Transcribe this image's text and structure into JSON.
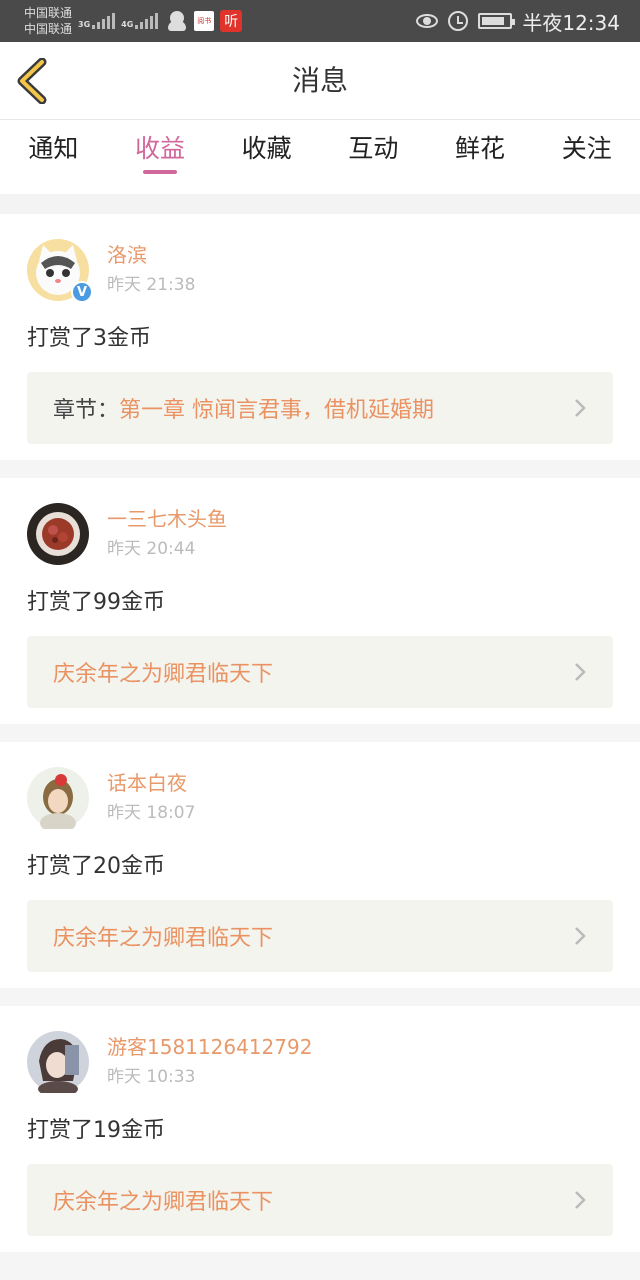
{
  "status_bar": {
    "carrier_1": "中国联通",
    "carrier_2": "中国联通",
    "net_1": "3G",
    "net_2": "4G",
    "app_icon_1": "阅书",
    "app_icon_2": "听",
    "time": "半夜12:34"
  },
  "header": {
    "title": "消息"
  },
  "tabs": [
    "通知",
    "收益",
    "收藏",
    "互动",
    "鲜花",
    "关注"
  ],
  "active_tab": "收益",
  "messages": [
    {
      "username": "洛滨",
      "time": "昨天 21:38",
      "reward": "打赏了3金币",
      "prefix": "章节：",
      "book": "第一章  惊闻言君事，借机延婚期"
    },
    {
      "username": "一三七木头鱼",
      "time": "昨天 20:44",
      "reward": "打赏了99金币",
      "prefix": "",
      "book": "庆余年之为卿君临天下"
    },
    {
      "username": "话本白夜",
      "time": "昨天 18:07",
      "reward": "打赏了20金币",
      "prefix": "",
      "book": "庆余年之为卿君临天下"
    },
    {
      "username": "游客1581126412792",
      "time": "昨天 10:33",
      "reward": "打赏了19金币",
      "prefix": "",
      "book": "庆余年之为卿君临天下"
    }
  ],
  "colors": {
    "accent": "#d1689c",
    "username": "#e8996a",
    "book_title": "#ea9262",
    "status_bar": "#4a4a4a"
  }
}
